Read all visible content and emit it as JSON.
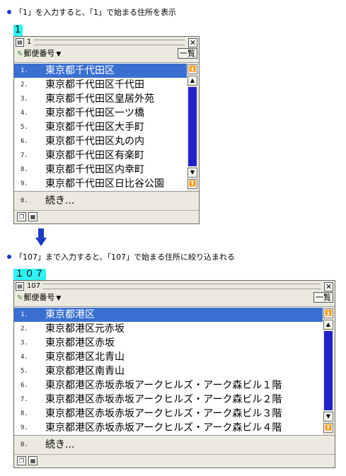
{
  "step1": {
    "caption": "「1」を入力すると、「1」で始まる住所を表示",
    "typed": "1",
    "window": {
      "title_text": "1",
      "close_glyph": "✕",
      "mode_label": "郵便番号",
      "list_button": "一覧",
      "items": [
        {
          "num": "1.",
          "addr": "東京都千代田区"
        },
        {
          "num": "2.",
          "addr": "東京都千代田区千代田"
        },
        {
          "num": "3.",
          "addr": "東京都千代田区皇居外苑"
        },
        {
          "num": "4.",
          "addr": "東京都千代田区一ツ橋"
        },
        {
          "num": "5.",
          "addr": "東京都千代田区大手町"
        },
        {
          "num": "6.",
          "addr": "東京都千代田区丸の内"
        },
        {
          "num": "7.",
          "addr": "東京都千代田区有楽町"
        },
        {
          "num": "8.",
          "addr": "東京都千代田区内幸町"
        },
        {
          "num": "9.",
          "addr": "東京都千代田区日比谷公園"
        }
      ],
      "more": {
        "num": "0.",
        "label": "続き..."
      }
    }
  },
  "step2": {
    "caption": "「107」まで入力すると、「107」で始まる住所に絞り込まれる",
    "typed": "１０７",
    "window": {
      "title_text": "107",
      "close_glyph": "✕",
      "mode_label": "郵便番号",
      "list_button": "一覧",
      "items": [
        {
          "num": "1.",
          "addr": "東京都港区"
        },
        {
          "num": "2.",
          "addr": "東京都港区元赤坂"
        },
        {
          "num": "3.",
          "addr": "東京都港区赤坂"
        },
        {
          "num": "4.",
          "addr": "東京都港区北青山"
        },
        {
          "num": "5.",
          "addr": "東京都港区南青山"
        },
        {
          "num": "6.",
          "addr": "東京都港区赤坂赤坂アークヒルズ・アーク森ビル１階"
        },
        {
          "num": "7.",
          "addr": "東京都港区赤坂赤坂アークヒルズ・アーク森ビル２階"
        },
        {
          "num": "8.",
          "addr": "東京都港区赤坂赤坂アークヒルズ・アーク森ビル３階"
        },
        {
          "num": "9.",
          "addr": "東京都港区赤坂赤坂アークヒルズ・アーク森ビル４階"
        }
      ],
      "more": {
        "num": "0.",
        "label": "続き..."
      }
    }
  },
  "colors": {
    "selection": "#3a6fd2",
    "typed_highlight": "#2ff2f2",
    "scroll_thumb": "#2222cc",
    "arrow": "#1a3cc8"
  }
}
